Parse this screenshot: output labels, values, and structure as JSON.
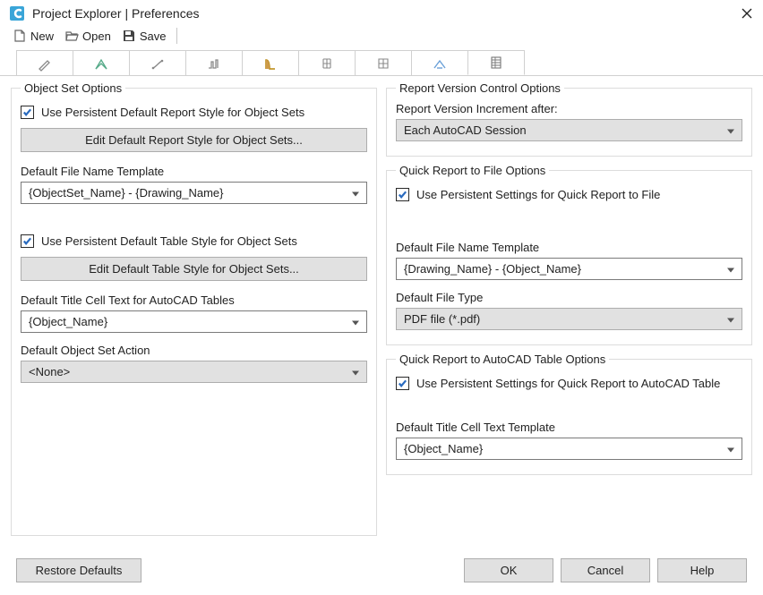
{
  "title": "Project Explorer | Preferences",
  "toolbar": {
    "new_label": "New",
    "open_label": "Open",
    "save_label": "Save"
  },
  "left": {
    "legend": "Object Set Options",
    "use_persist_report": "Use Persistent Default Report Style for Object Sets",
    "edit_default_report_btn": "Edit Default Report Style for Object Sets...",
    "filename_template_label": "Default File Name Template",
    "filename_template_value": "{ObjectSet_Name} - {Drawing_Name}",
    "use_persist_table": "Use Persistent Default Table Style for Object Sets",
    "edit_default_table_btn": "Edit Default Table Style for Object Sets...",
    "title_cell_label": "Default Title Cell Text for AutoCAD Tables",
    "title_cell_value": "{Object_Name}",
    "object_set_action_label": "Default Object Set Action",
    "object_set_action_value": "<None>"
  },
  "right_version": {
    "legend": "Report Version Control Options",
    "increment_label": "Report Version Increment after:",
    "increment_value": "Each AutoCAD Session"
  },
  "right_file": {
    "legend": "Quick Report to File Options",
    "use_persist": "Use Persistent Settings for Quick Report to File",
    "filename_template_label": "Default File Name Template",
    "filename_template_value": "{Drawing_Name} - {Object_Name}",
    "file_type_label": "Default File Type",
    "file_type_value": "PDF file (*.pdf)"
  },
  "right_table": {
    "legend": "Quick Report to AutoCAD Table Options",
    "use_persist": "Use Persistent Settings for Quick Report to AutoCAD Table",
    "title_cell_label": "Default Title Cell Text Template",
    "title_cell_value": "{Object_Name}"
  },
  "footer": {
    "restore": "Restore Defaults",
    "ok": "OK",
    "cancel": "Cancel",
    "help": "Help"
  }
}
